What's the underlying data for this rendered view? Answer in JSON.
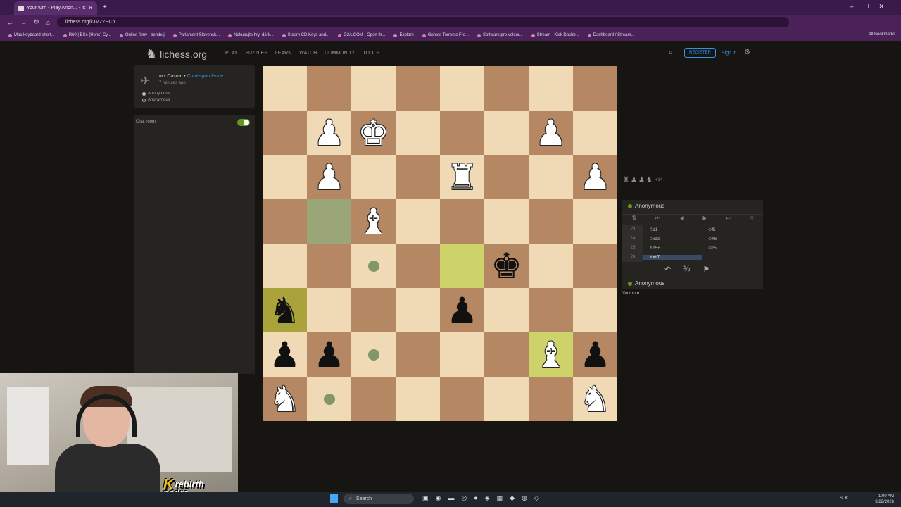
{
  "browser": {
    "tab_title": "Your turn - Play Anon... - liches...",
    "url": "lichess.org/kJMZZECn",
    "bookmarks": [
      "Mac keyboard short...",
      "R60 | BSc (Hons) Cy...",
      "Online filmy | bombuj",
      "Parlament Slovensk...",
      "Nakupujte hry, dárk...",
      "Steam CD Keys and...",
      "G2A.COM - Open th...",
      "Explore",
      "Games Torrents Fre...",
      "Software pro vektor...",
      "Stream - Kick Dashb...",
      "Dashboard / Stream..."
    ],
    "all_bookmarks": "All Bookmarks"
  },
  "site": {
    "logo": "lichess.org",
    "nav": [
      "PLAY",
      "PUZZLES",
      "LEARN",
      "WATCH",
      "COMMUNITY",
      "TOOLS"
    ],
    "register": "REGISTER",
    "signin": "Sign in"
  },
  "game": {
    "meta_prefix": "∞ • Casual • ",
    "meta_link": "Correspondence",
    "time_ago": "7 minutes ago",
    "players": [
      {
        "name": "Anonymous",
        "color": "white"
      },
      {
        "name": "Anonymous",
        "color": "black"
      }
    ],
    "chat_label": "Chat room",
    "material_plus": "+14",
    "top_player": "Anonymous",
    "bottom_player": "Anonymous",
    "status": "Your turn",
    "moves": [
      {
        "num": "23",
        "white": "♖d1",
        "black": "♔f5"
      },
      {
        "num": "24",
        "white": "♖xd3",
        "black": "♔h6"
      },
      {
        "num": "25",
        "white": "♗d5+",
        "black": "♔c5"
      },
      {
        "num": "26",
        "white": "♗xb7",
        "black": ""
      }
    ],
    "draw_symbol": "½"
  },
  "board": {
    "light_color": "#f0d9b5",
    "dark_color": "#b58863",
    "squares": [
      [
        "",
        "",
        "",
        "",
        "",
        "",
        "",
        ""
      ],
      [
        "",
        "P",
        "K",
        "",
        "",
        "",
        "P",
        ""
      ],
      [
        "",
        "P",
        "",
        "",
        "R",
        "",
        "",
        "P"
      ],
      [
        "",
        "",
        "B",
        "",
        "",
        "",
        "",
        ""
      ],
      [
        "",
        "",
        "",
        "",
        "",
        "k",
        "",
        ""
      ],
      [
        "n",
        "",
        "",
        "",
        "p",
        "",
        "",
        ""
      ],
      [
        "p",
        "p",
        "",
        "",
        "",
        "",
        "B",
        "p"
      ],
      [
        "N",
        "",
        "",
        "",
        "",
        "",
        "",
        "N"
      ]
    ],
    "move_dots": [
      [
        4,
        2
      ],
      [
        6,
        2
      ],
      [
        7,
        1
      ]
    ],
    "last_move": [
      [
        4,
        4
      ],
      [
        6,
        6
      ]
    ],
    "selected": [
      [
        3,
        1
      ],
      [
        5,
        0
      ]
    ]
  },
  "overlay": {
    "streamer_logo_top": "rebirth",
    "streamer_logo_bottom": "pedro"
  },
  "taskbar": {
    "search": "Search",
    "lang": "SLK",
    "time": "1:00 AM",
    "date": "3/22/2026"
  }
}
